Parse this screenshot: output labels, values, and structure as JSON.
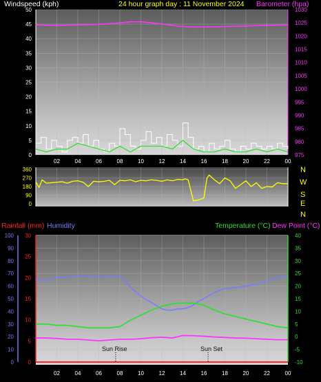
{
  "chart_data": [
    {
      "type": "line",
      "title": "24 hour graph day : 11 November 2024",
      "ylabel": "Windspeed (kph)",
      "ylabel_right": "Barometer (hpa)",
      "ylim": [
        0,
        50
      ],
      "ylim_right": [
        975,
        1030
      ],
      "xlim": [
        0,
        24
      ],
      "yticks": [
        "0",
        "5",
        "10",
        "15",
        "20",
        "25",
        "30",
        "35",
        "40",
        "45",
        "50"
      ],
      "yticks_right": [
        "975",
        "980",
        "985",
        "990",
        "995",
        "1000",
        "1005",
        "1010",
        "1015",
        "1020",
        "1025",
        "1030"
      ],
      "xticks": [
        "02",
        "04",
        "06",
        "08",
        "10",
        "12",
        "14",
        "16",
        "18",
        "20",
        "22",
        "00"
      ],
      "grid": true,
      "series": [
        {
          "name": "Windspeed",
          "axis": "left",
          "color": "#ffffff",
          "style": "gust",
          "x": [
            0,
            0.5,
            1,
            1.5,
            2,
            2.5,
            3,
            3.5,
            4,
            4.5,
            5,
            5.5,
            6,
            6.5,
            7,
            7.5,
            8,
            8.5,
            9,
            9.5,
            10,
            10.5,
            11,
            11.5,
            12,
            12.5,
            13,
            13.5,
            14,
            14.5,
            15,
            15.5,
            16,
            16.5,
            17,
            17.5,
            18,
            18.5,
            19,
            19.5,
            20,
            20.5,
            21,
            21.5,
            22,
            22.5,
            23,
            23.5,
            24
          ],
          "values": [
            4,
            6,
            2,
            5,
            3,
            1,
            5,
            6,
            4,
            7,
            3,
            5,
            2,
            1,
            4,
            3,
            9,
            7,
            3,
            2,
            5,
            8,
            4,
            6,
            3,
            7,
            5,
            3,
            11,
            6,
            2,
            3,
            1,
            4,
            2,
            3,
            5,
            2,
            1,
            3,
            2,
            4,
            3,
            2,
            3,
            2,
            4,
            3,
            2
          ]
        },
        {
          "name": "Average wind",
          "axis": "left",
          "color": "#33dd33",
          "x": [
            0,
            1,
            2,
            3,
            4,
            5,
            6,
            7,
            8,
            9,
            10,
            11,
            12,
            13,
            14,
            15,
            16,
            17,
            18,
            19,
            20,
            21,
            22,
            23,
            24
          ],
          "values": [
            2,
            1,
            2,
            2,
            4,
            3,
            2,
            1,
            3,
            1,
            3,
            3,
            3,
            2,
            5,
            2,
            1,
            1,
            2,
            1,
            1,
            2,
            1,
            2,
            1
          ]
        },
        {
          "name": "Barometer",
          "axis": "right",
          "color": "#ff33ff",
          "x": [
            0,
            2,
            4,
            6,
            8,
            9,
            10,
            11,
            12,
            13,
            14,
            15,
            16,
            18,
            20,
            22,
            24
          ],
          "values": [
            1024.2,
            1024.0,
            1024.2,
            1024.4,
            1025.0,
            1025.4,
            1025.4,
            1025.0,
            1024.6,
            1024.0,
            1023.6,
            1023.4,
            1023.4,
            1023.6,
            1023.8,
            1024.0,
            1024.2
          ]
        }
      ]
    },
    {
      "type": "line",
      "ylim": [
        0,
        360
      ],
      "xlim": [
        0,
        24
      ],
      "yticks": [
        "0",
        "90",
        "180",
        "270",
        "360"
      ],
      "right_labels": [
        "N",
        "W",
        "S",
        "E",
        "N"
      ],
      "series": [
        {
          "name": "Wind direction",
          "color": "#ffff00",
          "x": [
            0,
            0.3,
            0.6,
            1,
            1.5,
            2,
            2.5,
            3,
            3.5,
            4,
            4.5,
            5,
            5.5,
            6,
            6.5,
            7,
            7.5,
            8,
            8.5,
            9,
            9.5,
            10,
            10.5,
            11,
            11.5,
            12,
            12.5,
            13,
            13.5,
            14,
            14.2,
            14.5,
            15,
            15.5,
            16,
            16.3,
            16.5,
            17,
            17.5,
            18,
            18.5,
            19,
            19.5,
            20,
            20.5,
            21,
            21.5,
            22,
            22.5,
            23,
            23.5,
            24
          ],
          "values": [
            230,
            170,
            250,
            215,
            220,
            225,
            230,
            215,
            235,
            240,
            225,
            180,
            235,
            230,
            235,
            245,
            200,
            245,
            240,
            250,
            230,
            245,
            240,
            250,
            245,
            235,
            250,
            240,
            255,
            250,
            260,
            250,
            30,
            40,
            60,
            270,
            300,
            250,
            210,
            270,
            240,
            160,
            200,
            240,
            180,
            220,
            160,
            180,
            175,
            220,
            210,
            210
          ]
        }
      ]
    },
    {
      "type": "line",
      "ylabel": "Rainfall (mm)",
      "ylabel2": "Humidity",
      "ylabel_right": "Temperature (°C)",
      "ylabel_right2": "Dew Point (°C)",
      "xlim": [
        0,
        24
      ],
      "ylim_humidity": [
        0,
        100
      ],
      "ylim_rain": [
        0,
        30
      ],
      "ylim_temp": [
        -10,
        40
      ],
      "yticks_humidity": [
        "0",
        "10",
        "20",
        "30",
        "40",
        "50",
        "60",
        "70",
        "80",
        "90",
        "100"
      ],
      "yticks_rain": [
        "0",
        "5",
        "10",
        "15",
        "20",
        "25",
        "30"
      ],
      "yticks_temp": [
        "-10",
        "-5",
        "0",
        "5",
        "10",
        "15",
        "20",
        "25",
        "30",
        "35",
        "40"
      ],
      "xticks": [
        "02",
        "04",
        "06",
        "08",
        "10",
        "12",
        "14",
        "16",
        "18",
        "20",
        "22",
        "00"
      ],
      "annotations": [
        "Sun Rise",
        "Sun Set"
      ],
      "annotation_x": [
        7.6,
        16.4
      ],
      "series": [
        {
          "name": "Humidity",
          "axis": "humidity",
          "color": "#7b7bff",
          "x": [
            0,
            1,
            2,
            3,
            4,
            5,
            6,
            7,
            8,
            8.5,
            9,
            10,
            11,
            12,
            12.5,
            13,
            13.5,
            14,
            14.5,
            15,
            15.5,
            16,
            17,
            18,
            19,
            20,
            21,
            22,
            23,
            24
          ],
          "values": [
            65,
            64,
            67,
            67,
            68,
            68,
            67,
            68,
            68,
            64,
            59,
            52,
            47,
            42,
            41,
            41,
            42,
            42,
            43,
            45,
            48,
            50,
            55,
            58,
            59,
            60,
            61,
            64,
            67,
            68
          ]
        },
        {
          "name": "Temperature",
          "axis": "temp",
          "color": "#33dd33",
          "x": [
            0,
            1,
            2,
            3,
            4,
            5,
            6,
            7,
            8,
            9,
            10,
            11,
            12,
            13,
            14,
            15,
            16,
            17,
            18,
            19,
            20,
            21,
            22,
            23,
            24
          ],
          "values": [
            5,
            5,
            4.5,
            4.5,
            4,
            3.5,
            3.5,
            3.5,
            4,
            6.5,
            8.5,
            10.5,
            12,
            13,
            13.3,
            13.2,
            12.5,
            10.5,
            9,
            8,
            7,
            6,
            5,
            4,
            3.5
          ]
        },
        {
          "name": "Dew Point",
          "axis": "temp",
          "color": "#ff33ff",
          "x": [
            0,
            1,
            2,
            3,
            4,
            5,
            6,
            7,
            8,
            9,
            10,
            11,
            12,
            13,
            14,
            15,
            16,
            17,
            18,
            19,
            20,
            21,
            22,
            23,
            24
          ],
          "values": [
            -0.5,
            -0.5,
            -0.7,
            -1,
            -1,
            -1.3,
            -1.6,
            -1.3,
            -1,
            -1,
            -0.8,
            -0.4,
            -0.2,
            -0.5,
            0.5,
            0.4,
            0.2,
            -0.1,
            -0.3,
            -0.5,
            -0.6,
            -0.8,
            -1,
            -1.2,
            -1.2
          ]
        },
        {
          "name": "Rainfall",
          "axis": "rain",
          "color": "#ff2222",
          "x": [
            0,
            24
          ],
          "values": [
            0,
            0
          ]
        }
      ]
    }
  ],
  "colors": {
    "wind_label": "#ffffff",
    "title": "#ffff00",
    "barometer": "#ff33ff",
    "rain": "#ff2222",
    "humidity": "#7b7bff",
    "temperature": "#33dd33",
    "dewpoint": "#ff33ff",
    "direction": "#ffff00"
  }
}
